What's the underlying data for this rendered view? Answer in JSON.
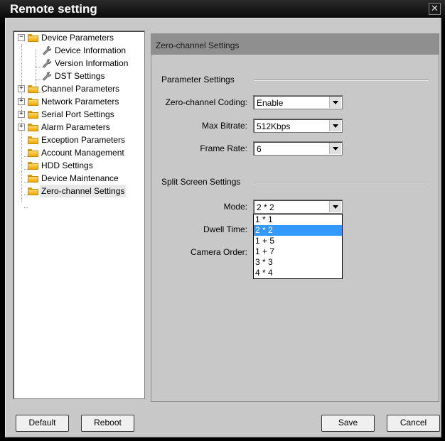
{
  "window": {
    "title": "Remote setting"
  },
  "tree": {
    "items": [
      {
        "label": "Device Parameters",
        "type": "folder",
        "expander": "−"
      },
      {
        "label": "Device Information",
        "type": "leaf"
      },
      {
        "label": "Version Information",
        "type": "leaf"
      },
      {
        "label": "DST Settings",
        "type": "leaf"
      },
      {
        "label": "Channel Parameters",
        "type": "folder",
        "expander": "+"
      },
      {
        "label": "Network Parameters",
        "type": "folder",
        "expander": "+"
      },
      {
        "label": "Serial Port Settings",
        "type": "folder",
        "expander": "+"
      },
      {
        "label": "Alarm Parameters",
        "type": "folder",
        "expander": "+"
      },
      {
        "label": "Exception Parameters",
        "type": "folder"
      },
      {
        "label": "Account Management",
        "type": "folder"
      },
      {
        "label": "HDD Settings",
        "type": "folder"
      },
      {
        "label": "Device Maintenance",
        "type": "folder"
      },
      {
        "label": "Zero-channel Settings",
        "type": "folder",
        "selected": true
      }
    ]
  },
  "panel": {
    "title": "Zero-channel Settings",
    "param_group": {
      "title": "Parameter Settings",
      "coding_label": "Zero-channel Coding:",
      "coding_value": "Enable",
      "bitrate_label": "Max Bitrate:",
      "bitrate_value": "512Kbps",
      "framerate_label": "Frame Rate:",
      "framerate_value": "6"
    },
    "split_group": {
      "title": "Split Screen Settings",
      "mode_label": "Mode:",
      "mode_value": "2 * 2",
      "dwell_label": "Dwell Time:",
      "camera_order_label": "Camera Order:",
      "mode_options": [
        "1 * 1",
        "2 * 2",
        "1 + 5",
        "1 + 7",
        "3 * 3",
        "4 * 4"
      ],
      "mode_selected_index": 1
    }
  },
  "buttons": {
    "default": "Default",
    "reboot": "Reboot",
    "save": "Save",
    "cancel": "Cancel"
  },
  "icons": {
    "close": "close-icon",
    "folder": "folder-icon",
    "leaf": "wrench-icon"
  }
}
